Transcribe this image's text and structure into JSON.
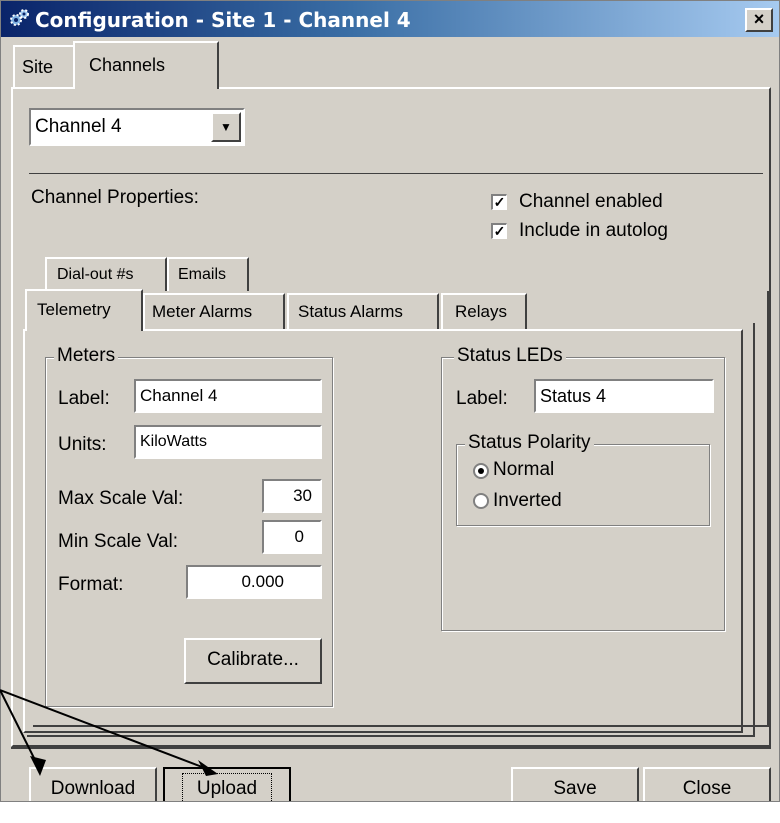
{
  "window": {
    "title": "Configuration - Site 1 - Channel  4",
    "close_label": "×",
    "title_icon": "gears-icon"
  },
  "top_tabs": [
    {
      "label": "Site",
      "selected": false
    },
    {
      "label": "Channels",
      "selected": true
    }
  ],
  "channel_select": {
    "value": "Channel  4",
    "arrow": "▼"
  },
  "channel_properties_label": "Channel Properties:",
  "checkboxes": [
    {
      "label": "Channel enabled",
      "checked": true
    },
    {
      "label": "Include in autolog",
      "checked": true
    }
  ],
  "inner_tabs_row1": [
    {
      "label": "Dial-out #s"
    },
    {
      "label": "Emails"
    }
  ],
  "inner_tabs_row2": [
    {
      "label": "Telemetry",
      "selected": true
    },
    {
      "label": "Meter Alarms"
    },
    {
      "label": "Status Alarms"
    },
    {
      "label": "Relays"
    }
  ],
  "meters": {
    "legend": "Meters",
    "label_caption": "Label:",
    "label_value": "Channel 4",
    "units_caption": "Units:",
    "units_value": "KiloWatts",
    "max_caption": "Max Scale Val:",
    "max_value": "30",
    "min_caption": "Min Scale Val:",
    "min_value": "0",
    "format_caption": "Format:",
    "format_value": "0.000",
    "calibrate_label": "Calibrate..."
  },
  "status_leds": {
    "legend": "Status LEDs",
    "label_caption": "Label:",
    "label_value": "Status 4",
    "polarity_legend": "Status Polarity",
    "options": [
      {
        "label": "Normal",
        "selected": true
      },
      {
        "label": "Inverted",
        "selected": false
      }
    ]
  },
  "buttons": {
    "download": "Download",
    "upload": "Upload",
    "save": "Save",
    "close": "Close"
  }
}
